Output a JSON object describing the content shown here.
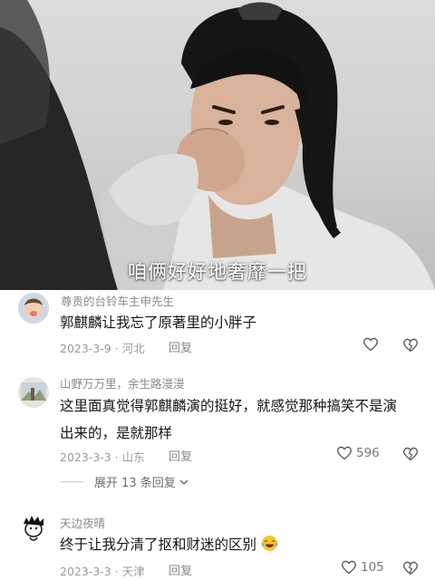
{
  "video": {
    "subtitle": "咱俩好好地奢靡一把"
  },
  "comments": [
    {
      "username": "尊贵的台铃车主申先生",
      "text": "郭麒麟让我忘了原著里的小胖子",
      "date": "2023-3-9",
      "location": "河北",
      "reply_label": "回复",
      "likes": ""
    },
    {
      "username": "山野万万里，余生路漫漫",
      "text": "这里面真觉得郭麒麟演的挺好，就感觉那种搞笑不是演出来的，是就那样",
      "date": "2023-3-3",
      "location": "山东",
      "reply_label": "回复",
      "likes": "596"
    },
    {
      "username": "天边夜晴",
      "text": "终于让我分清了抠和财迷的区别",
      "date": "2023-3-3",
      "location": "天津",
      "reply_label": "回复",
      "likes": "105"
    }
  ],
  "expand_replies": {
    "label": "展开 13 条回复"
  },
  "colors": {
    "text": "#161616",
    "muted": "#9a9a9a",
    "subtitle": "#ffffff"
  },
  "icons": [
    "heart-icon",
    "broken-heart-icon",
    "chevron-down-icon",
    "laughing-emoji-icon"
  ]
}
